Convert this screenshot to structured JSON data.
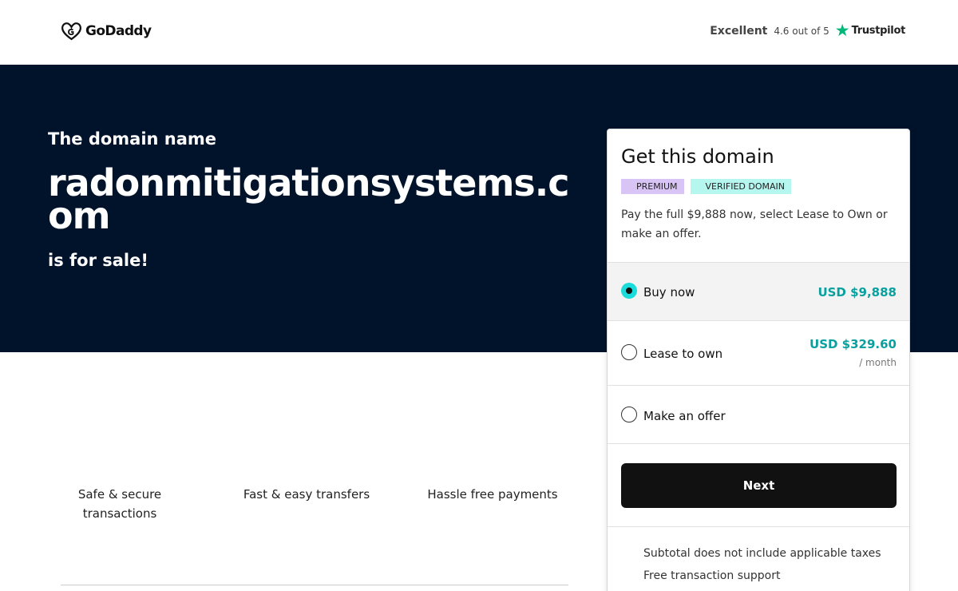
{
  "header": {
    "logo_text": "GoDaddy",
    "trustpilot": {
      "rating_word": "Excellent",
      "score_text": "4.6 out of 5",
      "brand": "Trustpilot",
      "star_icon": "star-icon"
    }
  },
  "hero": {
    "intro": "The domain name",
    "domain": "radonmitigationsystems.com",
    "outro": "is for sale!"
  },
  "features": [
    "Safe & secure transactions",
    "Fast & easy transfers",
    "Hassle free payments"
  ],
  "card": {
    "title": "Get this domain",
    "badges": [
      "PREMIUM",
      "VERIFIED DOMAIN"
    ],
    "description": "Pay the full $9,888 now, select Lease to Own or make an offer.",
    "options": [
      {
        "label": "Buy now",
        "price": "USD $9,888",
        "selected": true
      },
      {
        "label": "Lease to own",
        "price": "USD $329.60",
        "period": "/ month",
        "selected": false
      },
      {
        "label": "Make an offer",
        "selected": false
      }
    ],
    "next_label": "Next",
    "notes": [
      "Subtotal does not include applicable taxes",
      "Free transaction support"
    ]
  },
  "colors": {
    "hero_bg": "#00132b",
    "accent_teal": "#09a0a0",
    "radio_selected": "#1bdbdb",
    "premium_badge": "#d8c5f5",
    "verified_badge": "#b5f6ef",
    "trustpilot_green": "#00b67a"
  }
}
